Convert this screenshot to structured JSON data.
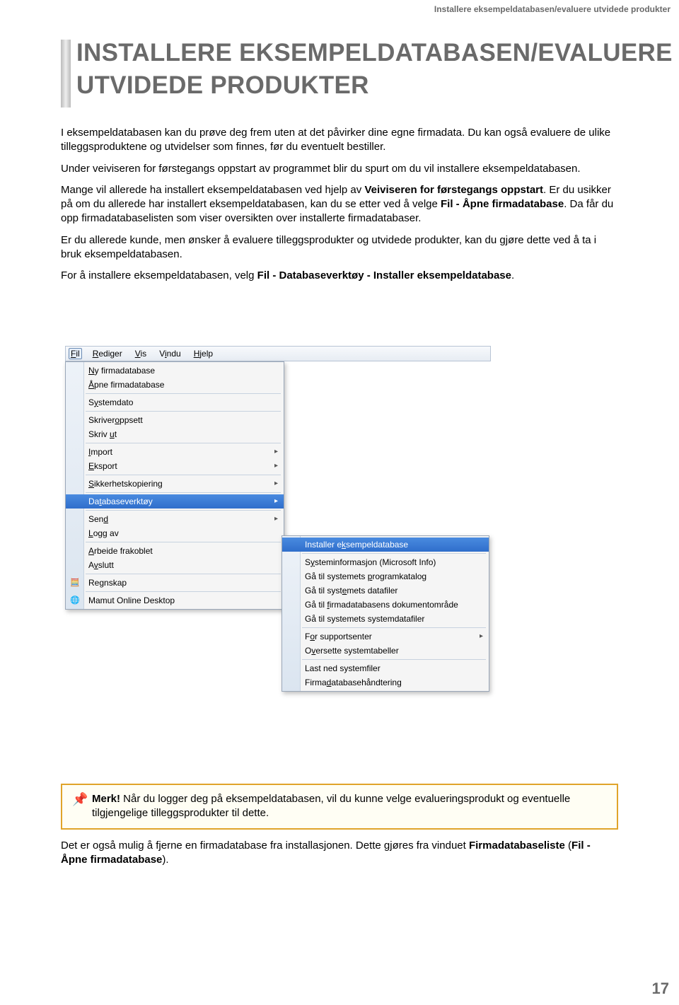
{
  "header_path": "Installere eksempeldatabasen/evaluere utvidede produkter",
  "title_line1": "INSTALLERE EKSEMPELDATABASEN/EVALUERE",
  "title_line2": "UTVIDEDE PRODUKTER",
  "para1": "I eksempeldatabasen kan du prøve deg frem uten at det påvirker dine egne firmadata. Du kan også evaluere de ulike tilleggsproduktene og utvidelser som finnes, før du eventuelt bestiller.",
  "para2": "Under veiviseren for førstegangs oppstart av programmet blir du spurt om du vil installere eksempeldatabasen.",
  "para3a": "Mange vil allerede ha installert eksempeldatabasen ved hjelp av ",
  "para3b": "Veiviseren for førstegangs oppstart",
  "para3c": ". Er du usikker på om du allerede har installert eksempeldatabasen, kan du se etter ved å velge ",
  "para3d": "Fil - Åpne firmadatabase",
  "para3e": ". Da får du opp firmadatabaselisten som viser oversikten over installerte firmadatabaser.",
  "para4": "Er du allerede kunde, men ønsker å evaluere tilleggsprodukter og utvidede produkter, kan du gjøre dette ved å ta i bruk eksempeldatabasen.",
  "para5a": "For å installere eksempeldatabasen, velg ",
  "para5b": "Fil - Databaseverktøy - Installer eksempeldatabase",
  "para5c": ".",
  "menubar": {
    "fil": "Fil",
    "rediger": "Rediger",
    "vis": "Vis",
    "vindu": "Vindu",
    "hjelp": "Hjelp"
  },
  "dropdown": {
    "ny": "Ny firmadatabase",
    "apne": "Åpne firmadatabase",
    "systemdato": "Systemdato",
    "skriveroppsett": "Skriveroppsett",
    "skrivut": "Skriv ut",
    "import": "Import",
    "eksport": "Eksport",
    "sikkerhet": "Sikkerhetskopiering",
    "databaseverktoy": "Databaseverktøy",
    "send": "Send",
    "loggav": "Logg av",
    "arbeide": "Arbeide frakoblet",
    "avslutt": "Avslutt",
    "regnskap": "Regnskap",
    "mamut": "Mamut Online Desktop"
  },
  "submenu": {
    "installer": "Installer eksempeldatabase",
    "sysinfo": "Systeminformasjon (Microsoft Info)",
    "progkat": "Gå til systemets programkatalog",
    "datafiler": "Gå til systemets datafiler",
    "dokomrade": "Gå til firmadatabasens dokumentområde",
    "sysdatafiler": "Gå til systemets systemdatafiler",
    "support": "For supportsenter",
    "oversette": "Oversette systemtabeller",
    "lastned": "Last ned systemfiler",
    "handtering": "Firmadatabasehåndtering"
  },
  "note_bold": "Merk!",
  "note_text": " Når du logger deg på eksempeldatabasen, vil du kunne velge evalueringsprodukt og eventuelle tilgjengelige tilleggsprodukter til dette.",
  "footer_a": "Det er også mulig å fjerne en firmadatabase fra installasjonen. Dette gjøres fra vinduet ",
  "footer_b": "Firmadatabaseliste",
  "footer_c": " (",
  "footer_d": "Fil - Åpne firmadatabase",
  "footer_e": ").",
  "page_number": "17"
}
